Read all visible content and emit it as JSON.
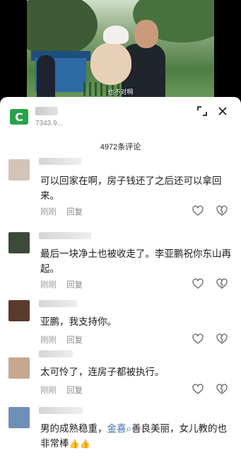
{
  "video": {
    "subtitle": "也不对啊"
  },
  "author": {
    "logo_icon": "green-c-logo",
    "subtitle": "7343.9..."
  },
  "comment_count": "4972条评论",
  "comments": [
    {
      "text": "可以回家在啊，房子钱还了之后还可以拿回来。",
      "time": "刚刚",
      "reply": "回复",
      "avatar_color": "#d2c4b8"
    },
    {
      "text": "最后一块净土也被收走了。李亚鹏祝你东山再起。",
      "time": "刚刚",
      "reply": "回复",
      "avatar_color": "#3c4a3a"
    },
    {
      "text": "亚鹏，我支持你。",
      "time": "刚刚",
      "reply": "回复",
      "avatar_color": "#5a3a2c"
    },
    {
      "text": "太可怜了，连房子都被执行。",
      "time": "刚刚",
      "reply": "回复",
      "avatar_color": "#c7a78e"
    },
    {
      "text_before": "男的成熟稳重，",
      "text_highlight": "金喜",
      "text_after": "善良美丽，女儿教的也非常棒",
      "emoji": "👍👍",
      "avatar_color": "#6f8fb8"
    }
  ]
}
